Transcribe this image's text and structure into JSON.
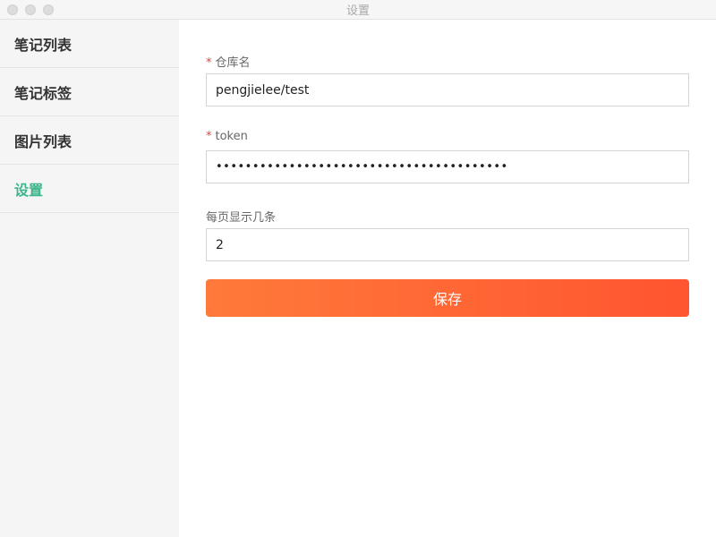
{
  "window": {
    "title": "设置"
  },
  "sidebar": {
    "items": [
      {
        "label": "笔记列表",
        "active": false
      },
      {
        "label": "笔记标签",
        "active": false
      },
      {
        "label": "图片列表",
        "active": false
      },
      {
        "label": "设置",
        "active": true
      }
    ]
  },
  "form": {
    "repo": {
      "required_mark": "*",
      "label": "仓库名",
      "value": "pengjielee/test"
    },
    "token": {
      "required_mark": "*",
      "label": "token",
      "value": "••••••••••••••••••••••••••••••••••••••••"
    },
    "page_size": {
      "label": "每页显示几条",
      "value": "2"
    },
    "save_label": "保存"
  },
  "colors": {
    "active_nav": "#3cb48a",
    "button_start": "#ff7a3a",
    "button_end": "#ff5530",
    "required": "#e8453c"
  }
}
